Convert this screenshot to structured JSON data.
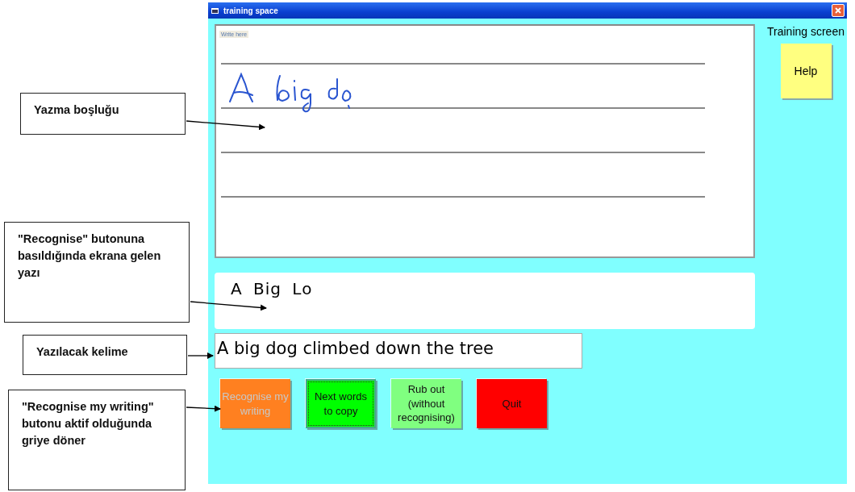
{
  "window": {
    "title": "training space"
  },
  "writing_area": {
    "label": "Write here"
  },
  "side_title": "Training screen",
  "help_button": {
    "label": "Help"
  },
  "recognised_text": "A Big Lo",
  "target_text": "A big dog climbed down the tree",
  "buttons": [
    {
      "label": "Recognise my writing",
      "color": "#ff8020",
      "disabled": true,
      "focused": false
    },
    {
      "label": "Next words to copy",
      "color": "#00ff00",
      "disabled": false,
      "focused": true
    },
    {
      "label": "Rub out (without recognising)",
      "color": "#80ff80",
      "disabled": false,
      "focused": false
    },
    {
      "label": "Quit",
      "color": "#ff0000",
      "disabled": false,
      "focused": false
    }
  ],
  "callouts": [
    {
      "text": "Yazma boşluğu"
    },
    {
      "text": "\"Recognise\" butonuna basıldığında ekrana gelen yazı"
    },
    {
      "text": "Yazılacak kelime"
    },
    {
      "text": "\"Recognise my writing\" butonu aktif olduğunda griye döner"
    }
  ]
}
